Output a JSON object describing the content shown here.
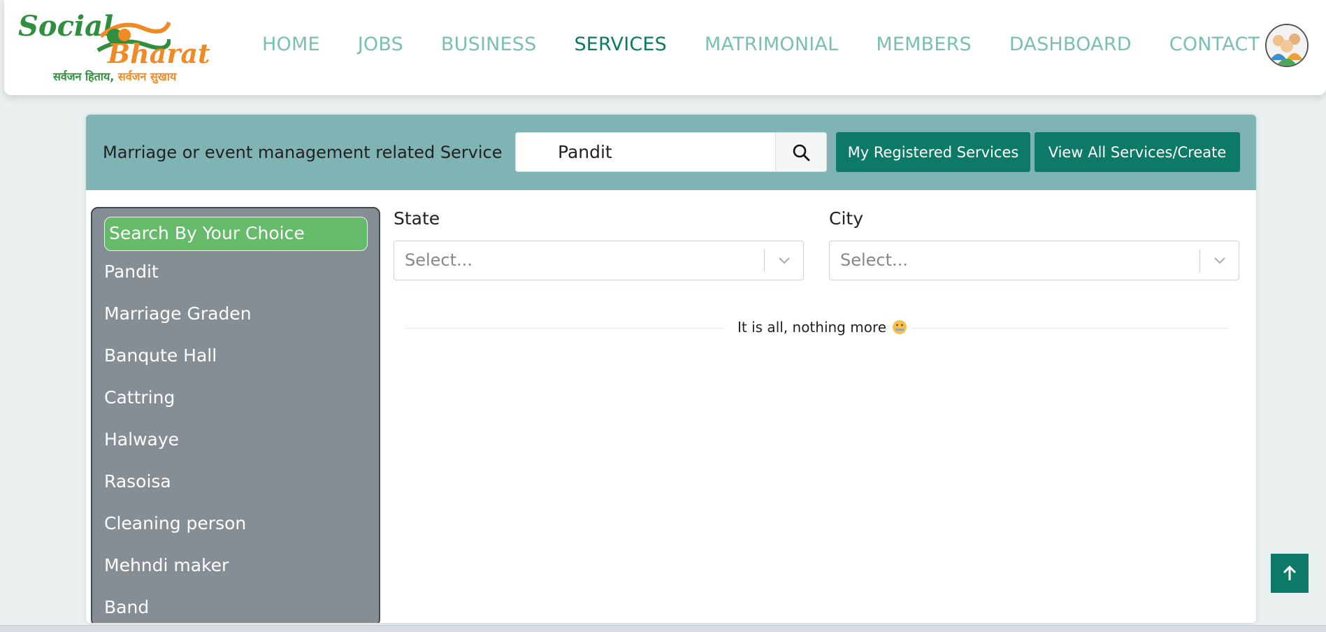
{
  "brand": {
    "name_part1": "Social",
    "name_part2": "Bharat",
    "tagline_part1": "सर्वजन हिताय,",
    "tagline_part2": "सर्वजन सुखाय"
  },
  "nav": {
    "items": [
      "HOME",
      "JOBS",
      "BUSINESS",
      "SERVICES",
      "MATRIMONIAL",
      "MEMBERS",
      "DASHBOARD",
      "CONTACT"
    ],
    "active": "SERVICES"
  },
  "service_header": {
    "title": "Marriage or event management related Service",
    "search_value": "Pandit",
    "my_registered_label": "My Registered Services",
    "view_all_label": "View All Services/Create"
  },
  "sidebar": {
    "heading": "Search By Your Choice",
    "items": [
      "Pandit",
      "Marriage Graden",
      "Banqute Hall",
      "Cattring",
      "Halwaye",
      "Rasoisa",
      "Cleaning person",
      "Mehndi maker",
      "Band"
    ]
  },
  "filters": {
    "state_label": "State",
    "city_label": "City",
    "state_placeholder": "Select...",
    "city_placeholder": "Select..."
  },
  "results": {
    "end_message": "It is all, nothing more"
  },
  "colors": {
    "accent": "#0d7a68",
    "nav_inactive": "#7bbfb3",
    "header_band": "#80b3b4",
    "sidebar_bg": "#858e95",
    "sidebar_heading": "#66bb6a"
  },
  "icons": {
    "search": "search-icon",
    "chevron": "chevron-down-icon",
    "scroll_top": "arrow-up-icon",
    "end_emoji": "zipper-mouth-face-icon"
  }
}
